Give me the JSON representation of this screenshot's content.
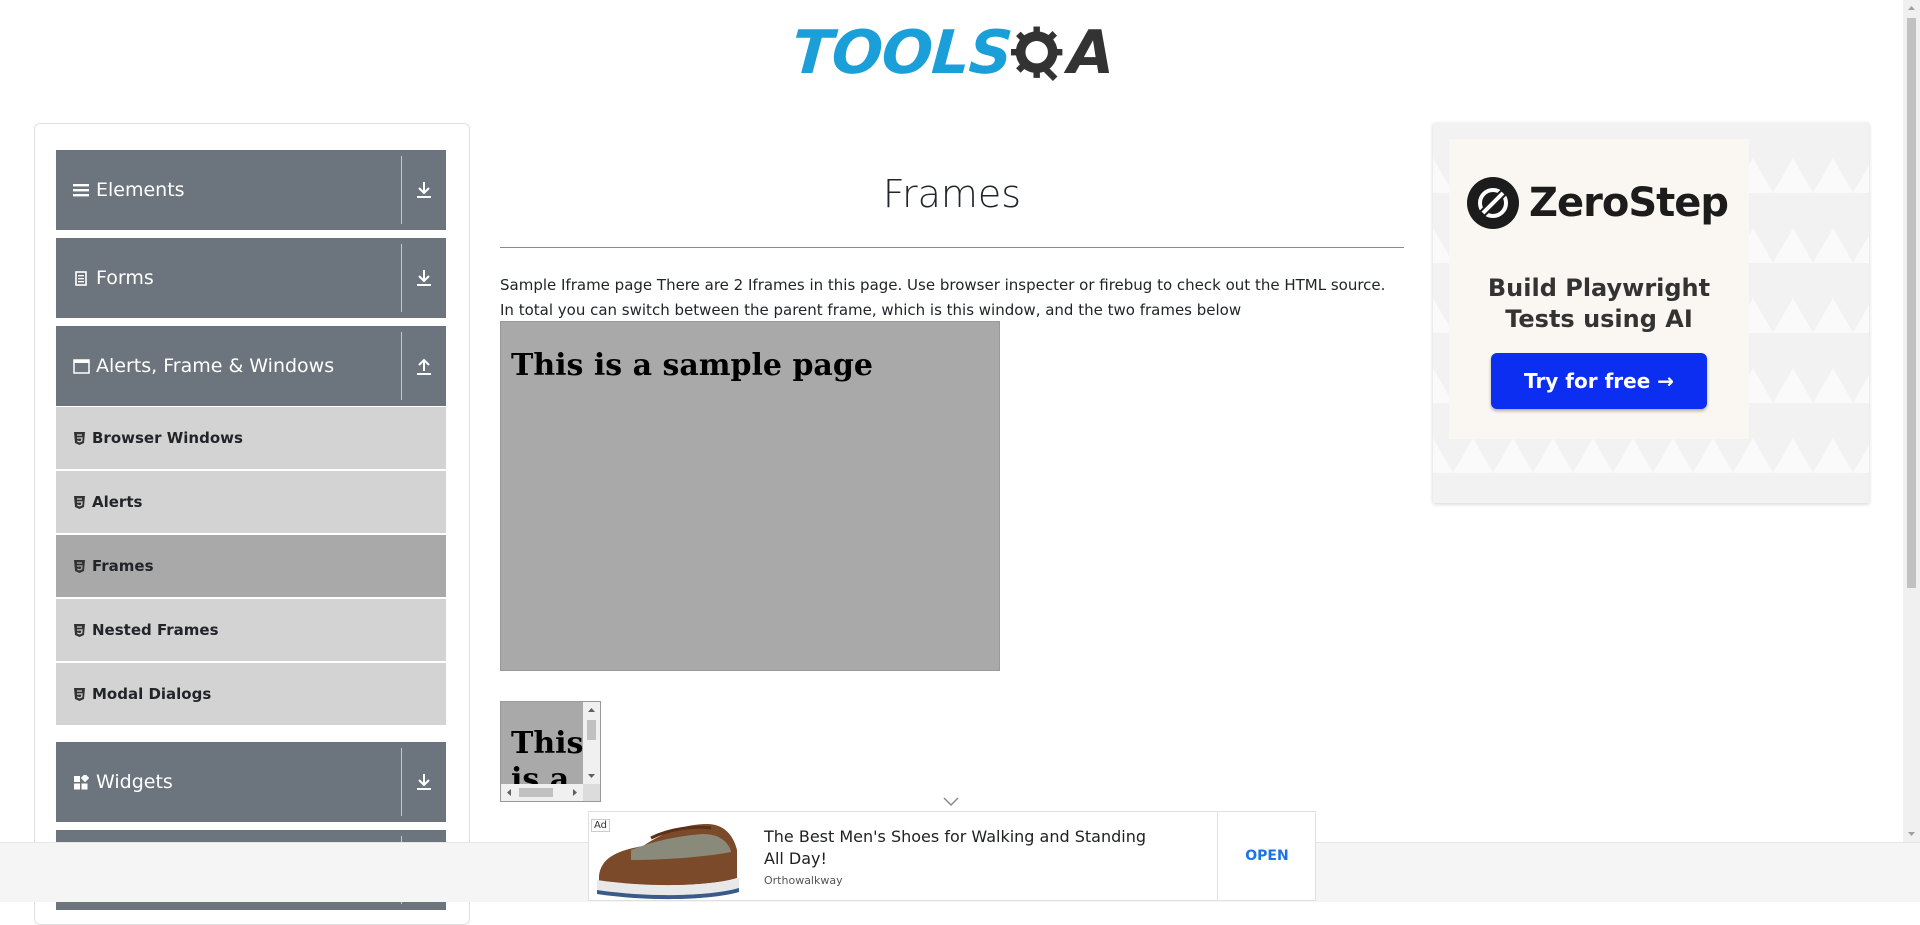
{
  "header": {
    "logo_text_primary": "TOOLS",
    "logo_text_secondary": "A",
    "logo_colors": {
      "primary": "#1b9fd9",
      "secondary": "#333333"
    }
  },
  "sidebar": {
    "groups": [
      {
        "label": "Elements",
        "icon": "hamburger-icon",
        "expanded": false
      },
      {
        "label": "Forms",
        "icon": "document-icon",
        "expanded": false
      },
      {
        "label": "Alerts, Frame & Windows",
        "icon": "window-icon",
        "expanded": true
      },
      {
        "label": "Widgets",
        "icon": "widgets-icon",
        "expanded": false
      }
    ],
    "alerts_items": [
      {
        "label": "Browser Windows",
        "active": false
      },
      {
        "label": "Alerts",
        "active": false
      },
      {
        "label": "Frames",
        "active": true
      },
      {
        "label": "Nested Frames",
        "active": false
      },
      {
        "label": "Modal Dialogs",
        "active": false
      }
    ],
    "colors": {
      "header_bg": "#6c757d",
      "item_bg": "#d3d3d3",
      "active_bg": "#a9a9a9"
    }
  },
  "main": {
    "title": "Frames",
    "description": "Sample Iframe page There are 2 Iframes in this page. Use browser inspecter or firebug to check out the HTML source. In total you can switch between the parent frame, which is this window, and the two frames below",
    "frame1": {
      "heading": "This is a sample page"
    },
    "frame2": {
      "heading": "This is a"
    }
  },
  "ad_right": {
    "brand": "ZeroStep",
    "tagline": "Build Playwright Tests using AI",
    "cta": "Try for free →",
    "cta_color": "#0b2ef0"
  },
  "ad_bottom": {
    "badge": "Ad",
    "title": "The Best Men's Shoes for Walking and Standing All Day!",
    "advertiser": "Orthowalkway",
    "cta": "OPEN"
  }
}
